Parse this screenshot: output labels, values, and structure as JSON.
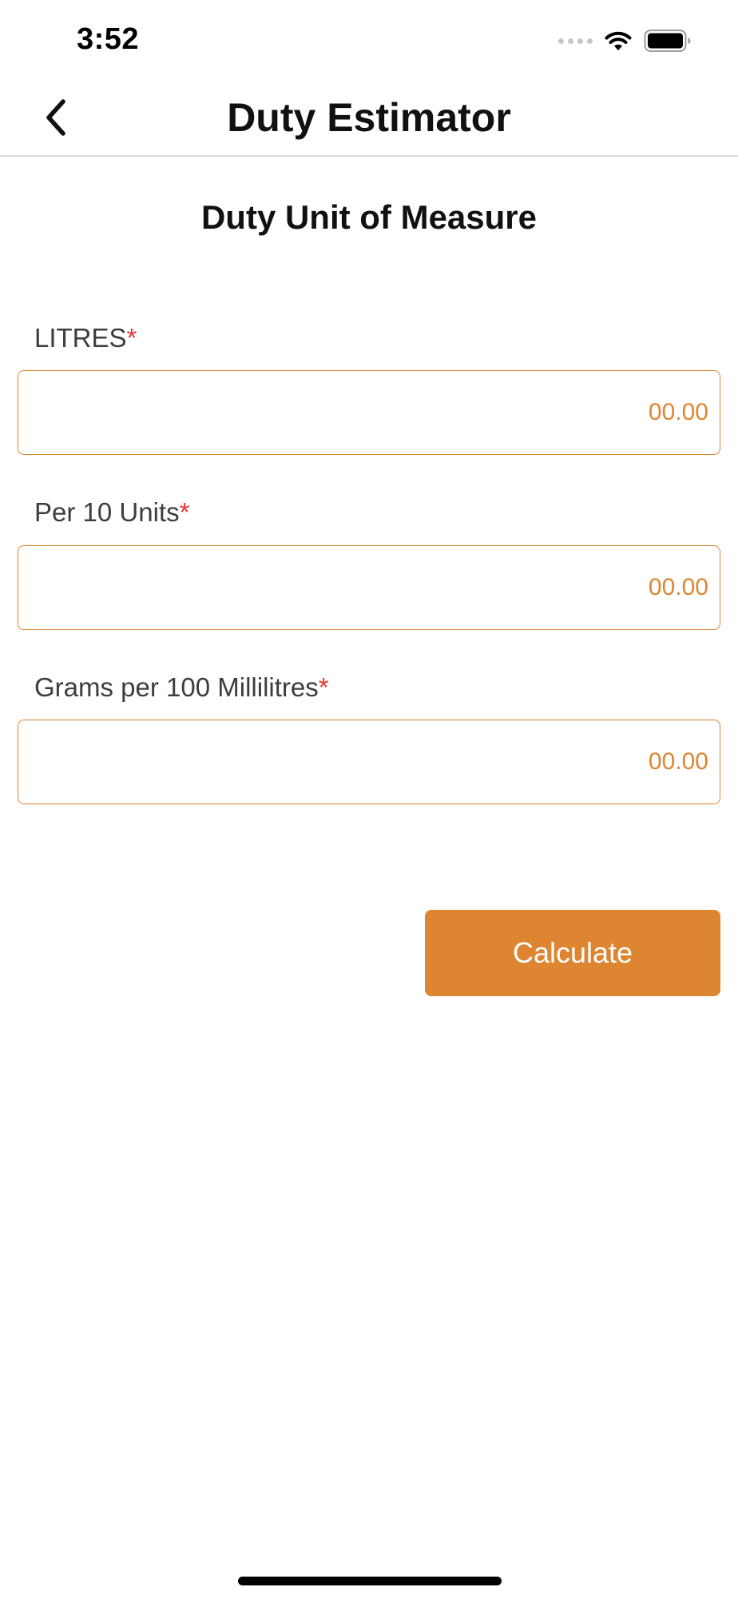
{
  "status_bar": {
    "time": "3:52",
    "icons": [
      "signal-icon",
      "wifi-icon",
      "battery-icon"
    ]
  },
  "nav": {
    "back_icon": "chevron-left-icon",
    "title": "Duty Estimator"
  },
  "form": {
    "section_title": "Duty Unit of Measure",
    "required_marker": "*",
    "fields": [
      {
        "label": "LITRES",
        "value": "",
        "placeholder": "00.00"
      },
      {
        "label": "Per 10 Units",
        "value": "",
        "placeholder": "00.00"
      },
      {
        "label": "Grams per 100 Millilitres",
        "value": "",
        "placeholder": "00.00"
      }
    ],
    "calculate_label": "Calculate"
  },
  "colors": {
    "accent": "#dd8530",
    "required": "#e53935",
    "label_text": "#3c3c43",
    "divider": "#d9d9d9"
  }
}
